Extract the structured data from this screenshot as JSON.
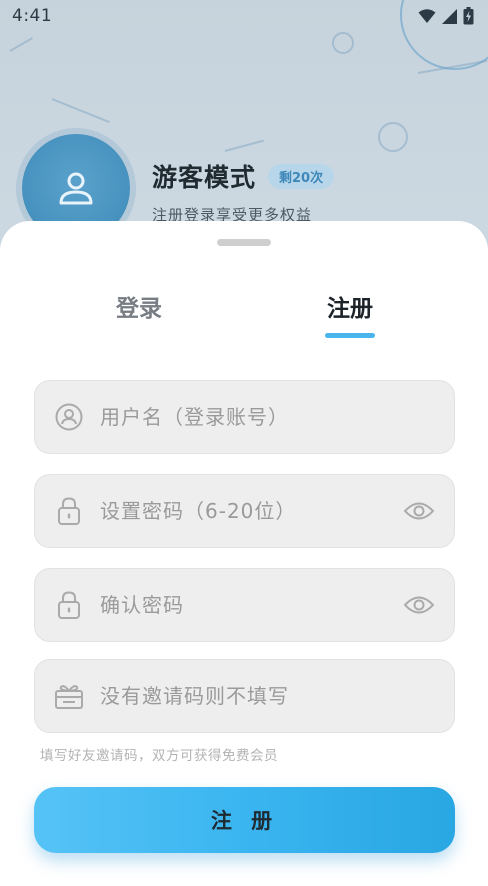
{
  "status_bar": {
    "time": "4:41"
  },
  "profile": {
    "title": "游客模式",
    "badge": "剩20次",
    "subtitle": "注册登录享受更多权益"
  },
  "tabs": {
    "login": "登录",
    "register": "注册",
    "active": "register"
  },
  "form": {
    "username_placeholder": "用户名（登录账号）",
    "password_placeholder": "设置密码（6-20位）",
    "confirm_placeholder": "确认密码",
    "invite_placeholder": "没有邀请码则不填写",
    "invite_hint": "填写好友邀请码，双方可获得免费会员",
    "submit_label": "注 册"
  },
  "icons": {
    "username": "user-circle-icon",
    "password": "lock-icon",
    "confirm": "lock-icon",
    "invite": "gift-icon",
    "toggle_visibility": "eye-icon"
  },
  "colors": {
    "accent": "#4ab4ec",
    "button_start": "#56c3f6",
    "button_end": "#28a7e3",
    "field_bg": "#eeeeee"
  }
}
